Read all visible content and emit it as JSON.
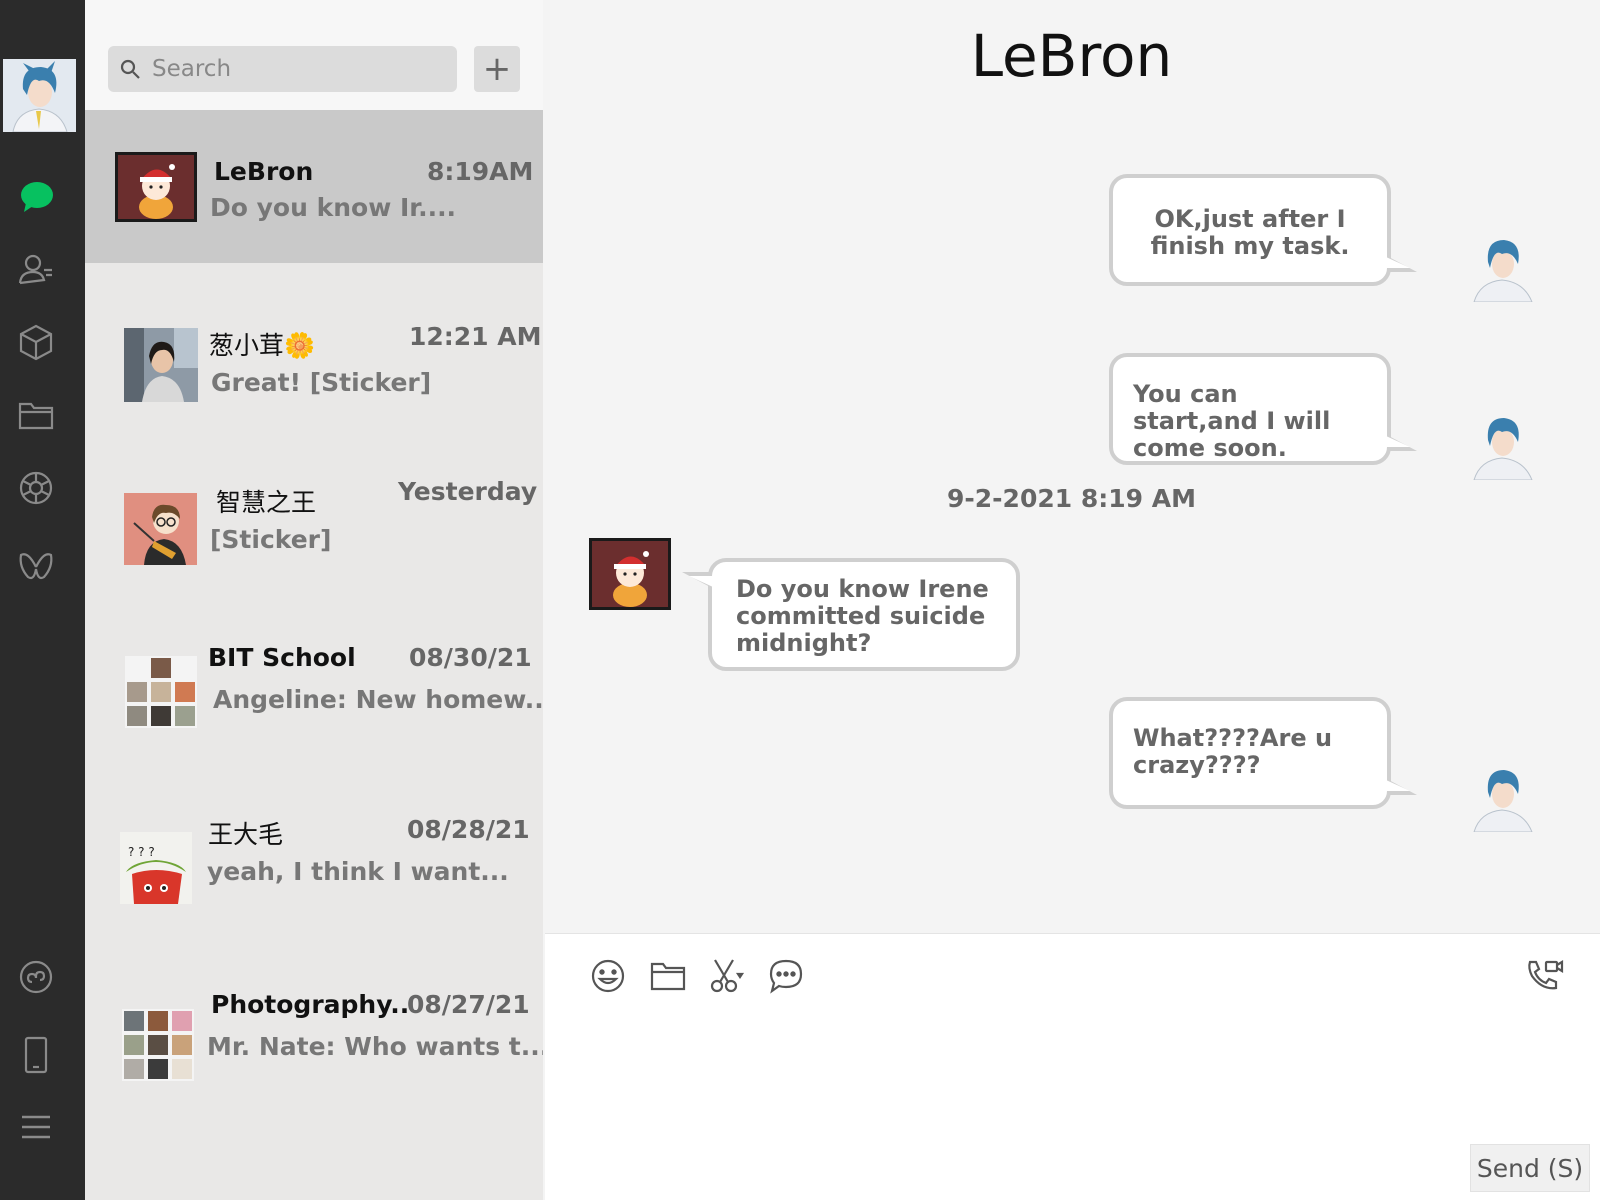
{
  "search": {
    "placeholder": "Search"
  },
  "add_button": "+",
  "chats": [
    {
      "name": "LeBron",
      "time": "8:19AM",
      "preview": "Do you know Ir....",
      "active": true
    },
    {
      "name": "葱小茸🌼",
      "time": "12:21 AM",
      "preview": "Great! [Sticker]"
    },
    {
      "name": "智慧之王",
      "time": "Yesterday",
      "preview": "[Sticker]"
    },
    {
      "name": "BIT School",
      "time": "08/30/21",
      "preview": "Angeline: New homew..."
    },
    {
      "name": "王大毛",
      "time": "08/28/21",
      "preview": "yeah, I think I want..."
    },
    {
      "name": "Photography..",
      "time": "08/27/21",
      "preview": "Mr. Nate: Who wants t..."
    }
  ],
  "conversation": {
    "title": "LeBron",
    "messages": [
      {
        "side": "right",
        "text": "OK,just after I finish my task."
      },
      {
        "side": "right",
        "text": "You can start,and I will come soon."
      },
      {
        "side": "left",
        "text": "Do you know Irene committed suicide midnight?"
      },
      {
        "side": "right",
        "text": "What????Are u crazy????"
      }
    ],
    "date_separator": "9-2-2021 8:19 AM"
  },
  "composer": {
    "send_label": "Send (S)"
  },
  "icons": {
    "rail": [
      "chat-icon",
      "contacts-icon",
      "cube-icon",
      "folder-icon",
      "moments-icon",
      "butterfly-icon",
      "mini-program-icon",
      "phone-icon",
      "menu-icon"
    ],
    "toolbar": [
      "emoji-icon",
      "folder-icon",
      "scissors-icon",
      "chat-history-icon",
      "voice-video-call-icon"
    ]
  },
  "colors": {
    "rail_bg": "#2b2b2b",
    "accent_green": "#07c160",
    "active_item_bg": "#c9c9c9"
  }
}
